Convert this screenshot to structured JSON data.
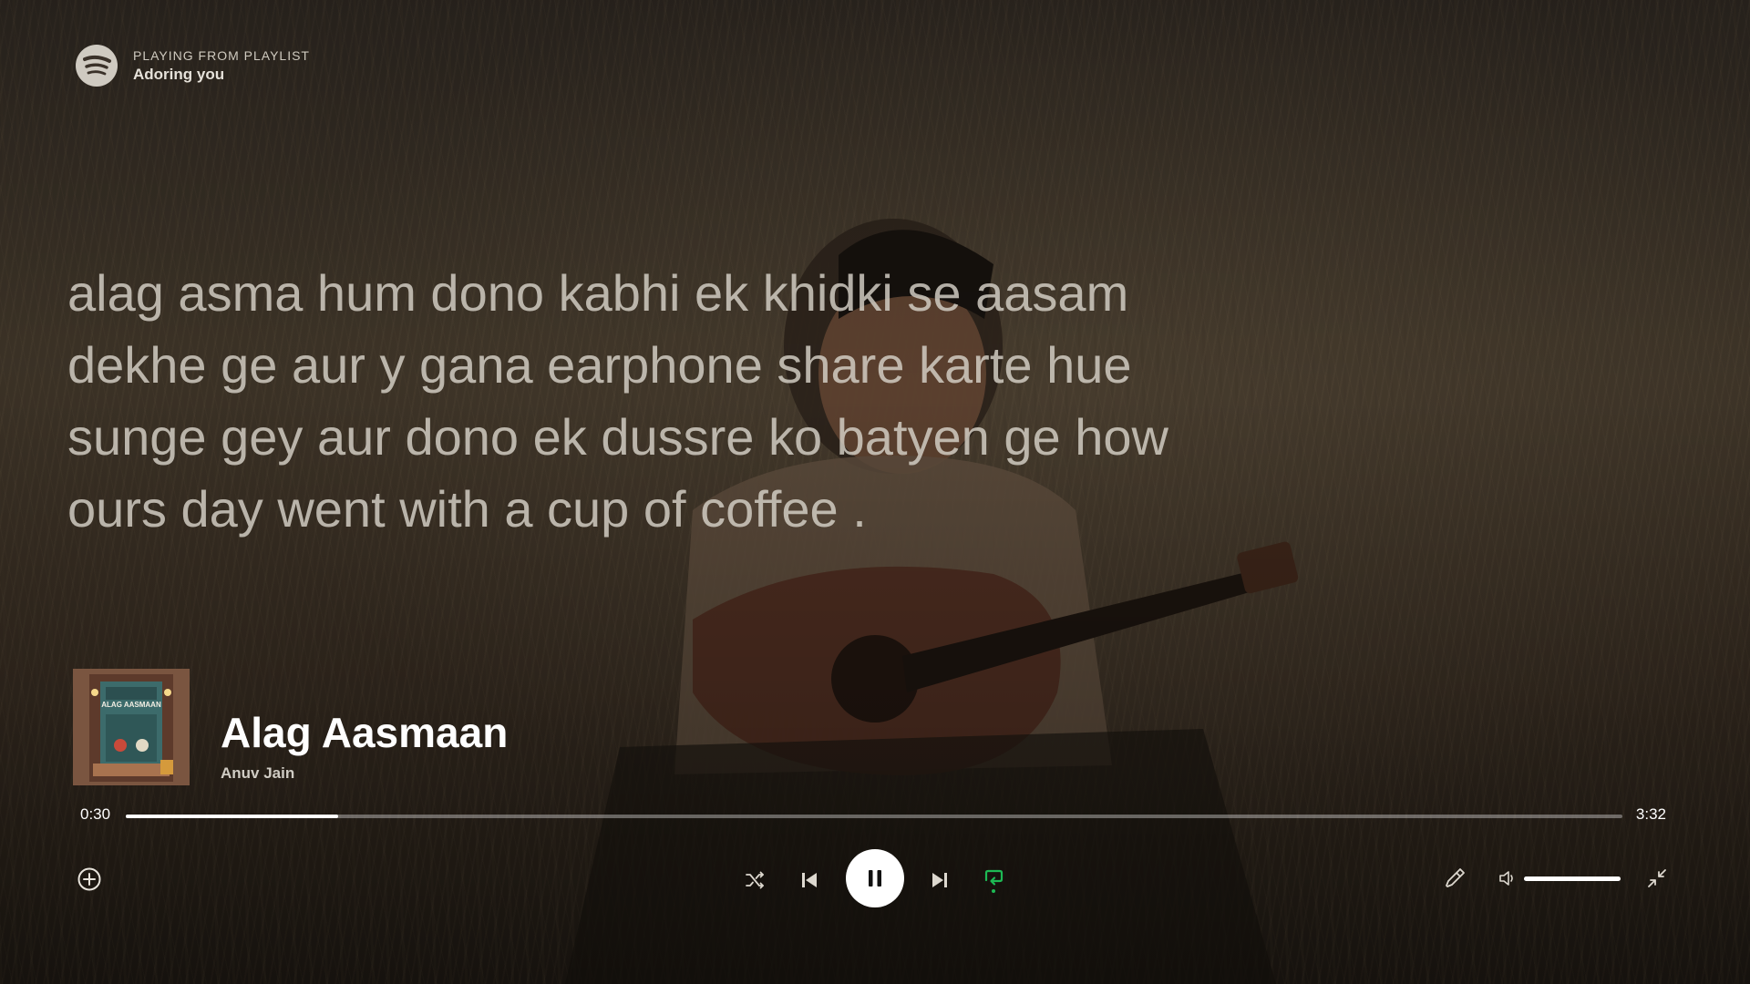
{
  "header": {
    "kicker": "PLAYING FROM PLAYLIST",
    "playlist_name": "Adoring you",
    "logo_icon": "spotify-logo-icon"
  },
  "lyrics": {
    "lines": [
      "alag asma hum dono kabhi ek khidki se aasam",
      "dekhe ge aur y gana earphone share karte hue",
      "sunge gey aur dono ek dussre ko batyen ge how",
      "ours day went with a cup of coffee ."
    ]
  },
  "track": {
    "title": "Alag Aasmaan",
    "artist": "Anuv Jain",
    "cover_text": "ALAG AASMAAN"
  },
  "playback": {
    "elapsed": "0:30",
    "duration": "3:32",
    "progress_fraction": 0.142,
    "volume_fraction": 1.0,
    "repeat_active": true
  },
  "colors": {
    "accent_green": "#1DB954",
    "text_primary": "#FFFFFF"
  },
  "icons": {
    "add": "add-circle-icon",
    "shuffle": "shuffle-icon",
    "previous": "skip-previous-icon",
    "play_pause": "pause-icon",
    "next": "skip-next-icon",
    "repeat": "repeat-icon",
    "connect": "pin-icon",
    "volume": "volume-icon",
    "exit_fullscreen": "minimize-icon"
  }
}
